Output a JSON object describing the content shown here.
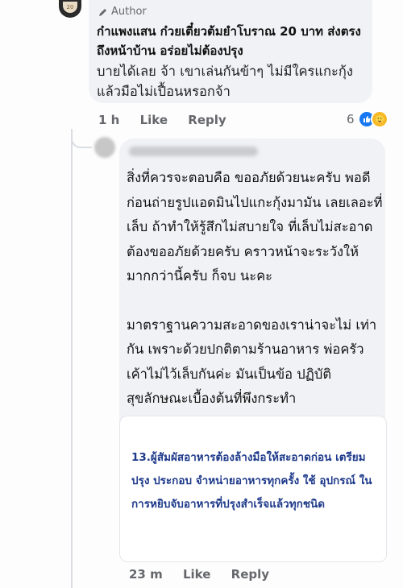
{
  "author_comment": {
    "badge": "Author",
    "avatar_text": "20",
    "headline": "ก๋าแพงแสน ก๋วยเตี๋ยวต้มยำโบราณ 20 บาท ส่งตรงถึงหน้าบ้าน อร่อยไม่ต้องปรุง",
    "body": "บายได้เลย จ้า เขาเล่นกันข้าๆ ไม่มีใครแกะกุ้งแล้วมือไม่เปื้อนหรอกจ้า",
    "time": "1 h",
    "like_label": "Like",
    "reply_label": "Reply",
    "reaction_count": "6"
  },
  "reply_comment": {
    "paragraph_1": "สิ่งที่ควรจะตอบคือ ขออภัยด้วยนะครับ พอดีก่อนถ่ายรูปแอดมินไปแกะกุ้งมามัน เลยเลอะที่เล็บ ถ้าทำให้รู้สึกไม่สบายใจ ที่เล็บไม่สะอาดต้องขออภัยด้วยครับ คราวหน้าจะระวังให้มากกว่านี้ครับ ก็จบ นะคะ",
    "paragraph_2": "มาตราฐานความสะอาดของเราน่าจะไม่ เท่ากัน เพราะด้วยปกติตามร้านอาหาร พ่อครัวเค้าไม่ไว้เล็บกันค่ะ มันเป็นข้อ ปฏิบัติสุขลักษณะเบื้องต้นที่พึงกระทำ",
    "quote": "13.ผู้สัมผัสอาหารต้องล้างมือให้สะอาดก่อน เตรียมปรุง ประกอบ จำหน่ายอาหารทุกครั้ง ใช้ อุปกรณ์ ในการหยิบจับอาหารที่ปรุงสำเร็จแล้วทุกชนิด",
    "time": "23 m",
    "like_label": "Like",
    "reply_label": "Reply"
  },
  "colors": {
    "bubble": "#f0f2f5",
    "meta_text": "#65676b",
    "like_blue": "#1877f2",
    "quote_text": "#1e3a8a"
  }
}
